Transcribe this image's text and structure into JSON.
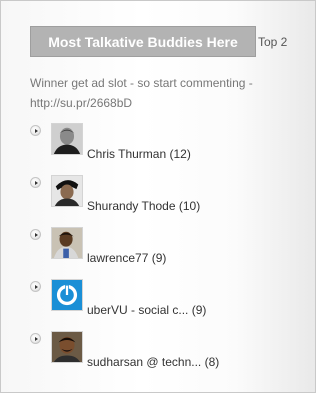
{
  "widget": {
    "title": "Most Talkative Buddies Here",
    "top_link": "Top 2",
    "description": "Winner get ad slot - so start commenting -",
    "url": "http://su.pr/2668bD"
  },
  "buddies": [
    {
      "name": "Chris Thurman",
      "count": "(12)",
      "avatar_icon": "avatar-photo"
    },
    {
      "name": "Shurandy Thode",
      "count": "(10)",
      "avatar_icon": "avatar-photo"
    },
    {
      "name": "lawrence77",
      "count": "(9)",
      "avatar_icon": "avatar-photo"
    },
    {
      "name": "uberVU - social c...",
      "count": "(9)",
      "avatar_icon": "ubervu-logo-icon",
      "brand_color": "#1a8fd6"
    },
    {
      "name": "sudharsan @ techn...",
      "count": "(8)",
      "avatar_icon": "avatar-photo"
    }
  ]
}
